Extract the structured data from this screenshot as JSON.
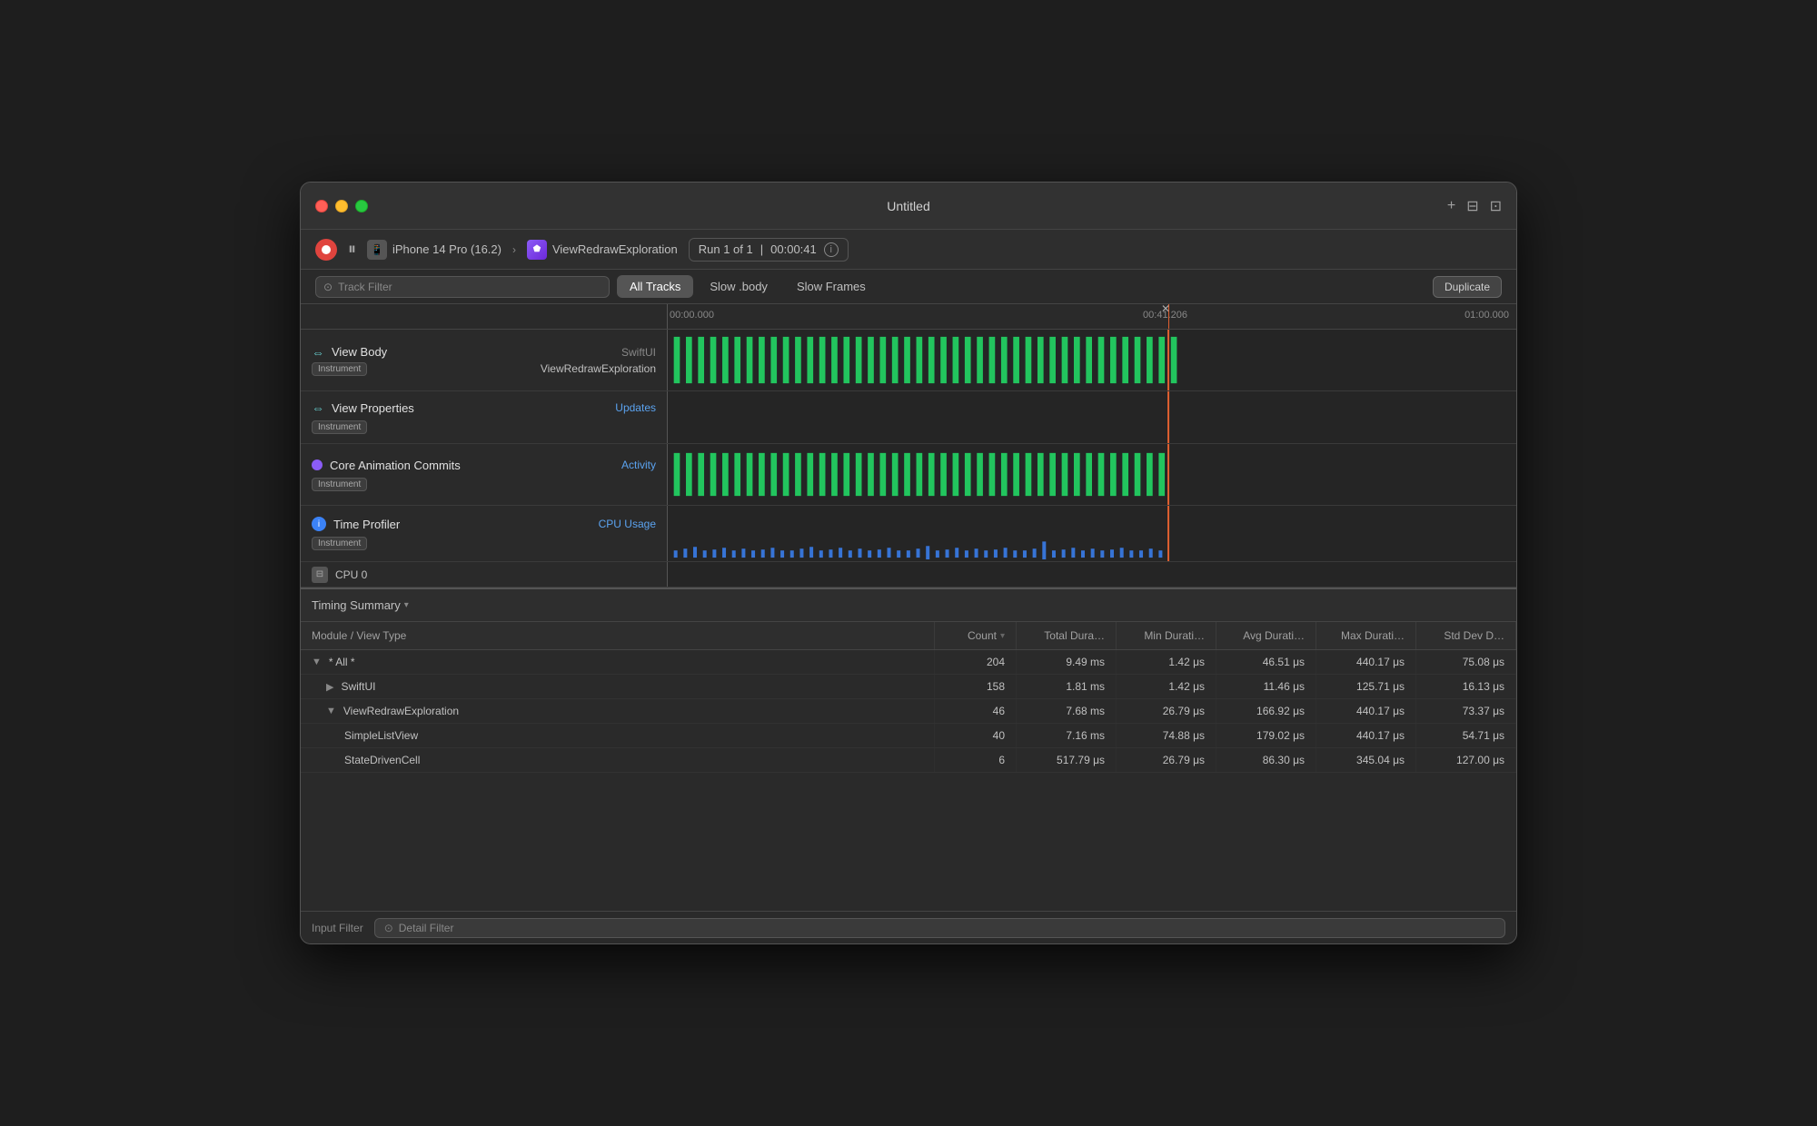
{
  "window": {
    "title": "Untitled",
    "traffic_lights": {
      "close_color": "#ff5f57",
      "minimize_color": "#ffbd2e",
      "maximize_color": "#28c840"
    }
  },
  "toolbar": {
    "device": "iPhone 14 Pro (16.2)",
    "app": "ViewRedrawExploration",
    "run": "Run 1 of 1",
    "duration": "00:00:41",
    "pause_label": "⏸",
    "add_label": "+",
    "duplicate_label": "Duplicate"
  },
  "tabs": {
    "all_tracks": "All Tracks",
    "slow_body": "Slow .body",
    "slow_frames": "Slow Frames",
    "active": "All Tracks"
  },
  "filter": {
    "track_placeholder": "Track Filter"
  },
  "timeline": {
    "time_start": "00:00.000",
    "time_mid": "00:41.206",
    "time_end": "01:00.000",
    "playhead_pos_pct": 59
  },
  "tracks": [
    {
      "id": "view-body",
      "icon": "expand",
      "name": "View Body",
      "badge": "Instrument",
      "type": "SwiftUI",
      "subtitle": "ViewRedrawExploration",
      "bar_color": "#22c55e",
      "bar_type": "green"
    },
    {
      "id": "view-properties",
      "icon": "expand",
      "name": "View Properties",
      "badge": "Instrument",
      "type": "",
      "subtitle": "Updates",
      "subtitle_color": "#5ba3f0",
      "bar_color": "",
      "bar_type": "empty"
    },
    {
      "id": "core-animation",
      "icon": "diamond",
      "name": "Core Animation Commits",
      "badge": "Instrument",
      "type": "",
      "subtitle": "Activity",
      "subtitle_color": "#5ba3f0",
      "bar_color": "#22c55e",
      "bar_type": "green"
    },
    {
      "id": "time-profiler",
      "icon": "info-blue",
      "name": "Time Profiler",
      "badge": "Instrument",
      "type": "",
      "subtitle": "CPU Usage",
      "subtitle_color": "#5ba3f0",
      "bar_color": "#3b82f6",
      "bar_type": "blue-small"
    }
  ],
  "cpu_row": {
    "name": "CPU 0"
  },
  "bottom_panel": {
    "timing_label": "Timing Summary"
  },
  "table": {
    "columns": [
      {
        "key": "module",
        "label": "Module / View Type",
        "sortable": false
      },
      {
        "key": "count",
        "label": "Count",
        "sortable": true
      },
      {
        "key": "total_dur",
        "label": "Total Dura…"
      },
      {
        "key": "min_dur",
        "label": "Min Durati…"
      },
      {
        "key": "avg_dur",
        "label": "Avg Durati…"
      },
      {
        "key": "max_dur",
        "label": "Max Durati…"
      },
      {
        "key": "std_dev",
        "label": "Std Dev D…"
      }
    ],
    "rows": [
      {
        "indent": 0,
        "toggle": "▼",
        "name": "* All *",
        "count": "204",
        "total_dur": "9.49 ms",
        "min_dur": "1.42 μs",
        "avg_dur": "46.51 μs",
        "max_dur": "440.17 μs",
        "std_dev": "75.08 μs"
      },
      {
        "indent": 1,
        "toggle": "▶",
        "name": "SwiftUI",
        "count": "158",
        "total_dur": "1.81 ms",
        "min_dur": "1.42 μs",
        "avg_dur": "11.46 μs",
        "max_dur": "125.71 μs",
        "std_dev": "16.13 μs"
      },
      {
        "indent": 1,
        "toggle": "▼",
        "name": "ViewRedrawExploration",
        "count": "46",
        "total_dur": "7.68 ms",
        "min_dur": "26.79 μs",
        "avg_dur": "166.92 μs",
        "max_dur": "440.17 μs",
        "std_dev": "73.37 μs"
      },
      {
        "indent": 2,
        "toggle": "",
        "name": "SimpleListView",
        "count": "40",
        "total_dur": "7.16 ms",
        "min_dur": "74.88 μs",
        "avg_dur": "179.02 μs",
        "max_dur": "440.17 μs",
        "std_dev": "54.71 μs"
      },
      {
        "indent": 2,
        "toggle": "",
        "name": "StateDrivenCell",
        "count": "6",
        "total_dur": "517.79 μs",
        "min_dur": "26.79 μs",
        "avg_dur": "86.30 μs",
        "max_dur": "345.04 μs",
        "std_dev": "127.00 μs"
      }
    ]
  },
  "bottom_bar": {
    "input_filter": "Input Filter",
    "detail_filter": "Detail Filter"
  }
}
